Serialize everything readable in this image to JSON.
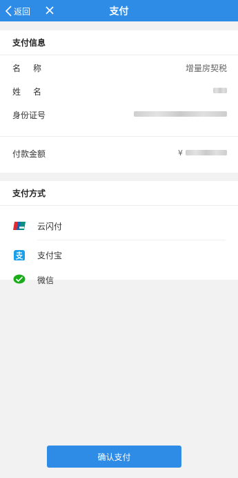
{
  "header": {
    "back_label": "返回",
    "title": "支付"
  },
  "info": {
    "section_title": "支付信息",
    "name_label": "名称",
    "name_value": "增量房契税",
    "person_label": "姓名",
    "id_label": "身份证号",
    "amount_label": "付款金额",
    "amount_currency": "¥"
  },
  "methods": {
    "section_title": "支付方式",
    "items": [
      {
        "label": "云闪付",
        "icon": "unionpay-icon"
      },
      {
        "label": "支付宝",
        "icon": "alipay-icon"
      },
      {
        "label": "微信",
        "icon": "wechat-pay-icon"
      }
    ]
  },
  "footer": {
    "confirm_label": "确认支付"
  },
  "colors": {
    "accent": "#2e8ce6",
    "alipay": "#1aa0ea",
    "wechat": "#1aad19",
    "unionpay_red": "#e02a30",
    "unionpay_blue": "#1565b5"
  }
}
